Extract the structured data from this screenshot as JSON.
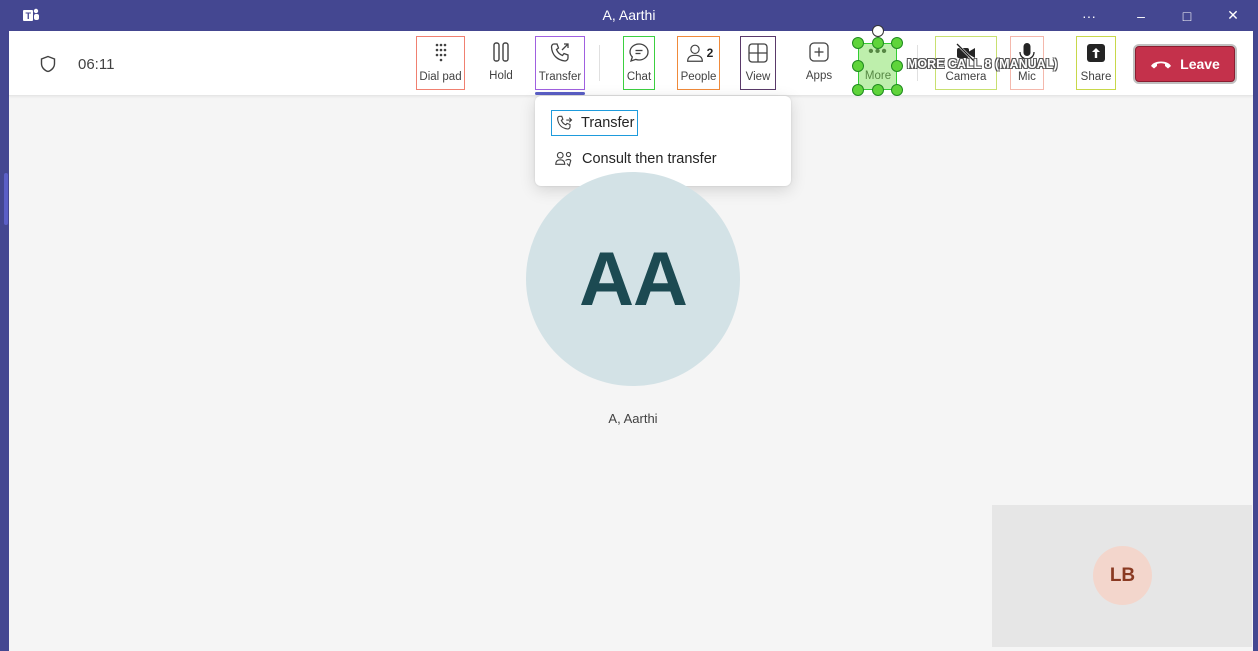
{
  "window": {
    "title": "A, Aarthi",
    "controls": {
      "more": "···",
      "minimize": "–",
      "maximize": "□",
      "close": "✕"
    }
  },
  "call": {
    "timer": "06:11"
  },
  "toolbar": {
    "dialpad": "Dial pad",
    "hold": "Hold",
    "transfer": "Transfer",
    "chat": "Chat",
    "people": "People",
    "people_count": "2",
    "view": "View",
    "apps": "Apps",
    "more": "More",
    "camera": "Camera",
    "mic": "Mic",
    "share": "Share",
    "leave": "Leave"
  },
  "transfer_menu": {
    "items": [
      {
        "label": "Transfer",
        "icon": "phone-transfer-icon"
      },
      {
        "label": "Consult then transfer",
        "icon": "people-consult-icon"
      }
    ]
  },
  "participants": {
    "main": {
      "initials": "AA",
      "name": "A, Aarthi"
    },
    "self": {
      "initials": "LB"
    }
  },
  "annotation": {
    "label": "MORE CALL 8 (MANUAL)"
  },
  "colors": {
    "titlebar": "#444791",
    "leave": "#c4314b",
    "accent": "#5b5fc7"
  }
}
